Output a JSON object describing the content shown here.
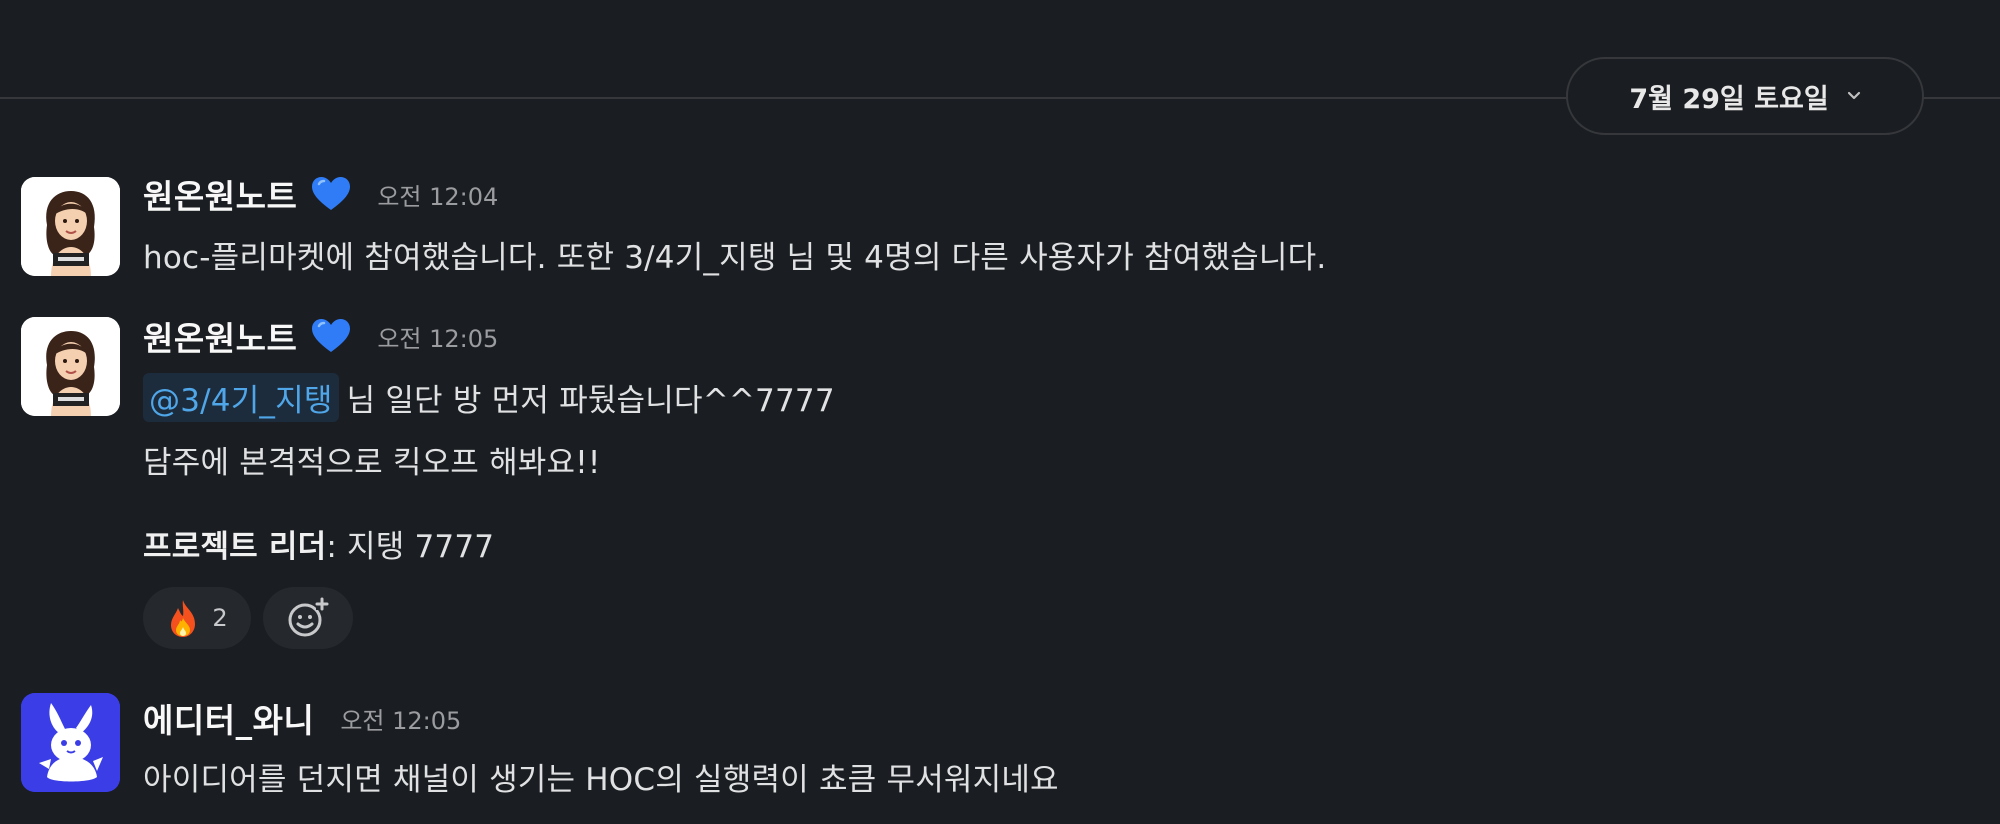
{
  "date_divider": {
    "label": "7월 29일 토요일",
    "icon": "chevron-down-icon"
  },
  "messages": [
    {
      "sender": "원온원노트",
      "sender_badge": "blue-heart-icon",
      "time": "오전 12:04",
      "text": "hoc-플리마켓에 참여했습니다. 또한 3/4기_지탱 님 및 4명의 다른 사용자가 참여했습니다."
    },
    {
      "sender": "원온원노트",
      "sender_badge": "blue-heart-icon",
      "time": "오전 12:05",
      "mention": "@3/4기_지탱",
      "line1_rest": "님 일단 방 먼저 파뒀습니다^^7777",
      "line2": "담주에 본격적으로 킥오프 해봐요!!",
      "line3_label": "프로젝트 리더",
      "line3_rest": ": 지탱 7777",
      "reactions": [
        {
          "emoji": "fire-emoji",
          "count": "2"
        }
      ],
      "add_reaction_icon": "add-emoji-icon"
    },
    {
      "sender": "에디터_와니",
      "time": "오전 12:05",
      "text": "아이디어를 던지면 채널이 생기는 HOC의 실행력이 쵸큼 무서워지네요"
    }
  ],
  "colors": {
    "background": "#1a1d21",
    "mention_text": "#4fa6e8",
    "mention_bg": "#1d2c3c",
    "heart": "#2f7cf6",
    "avatar_blue": "#3b3ee6"
  }
}
